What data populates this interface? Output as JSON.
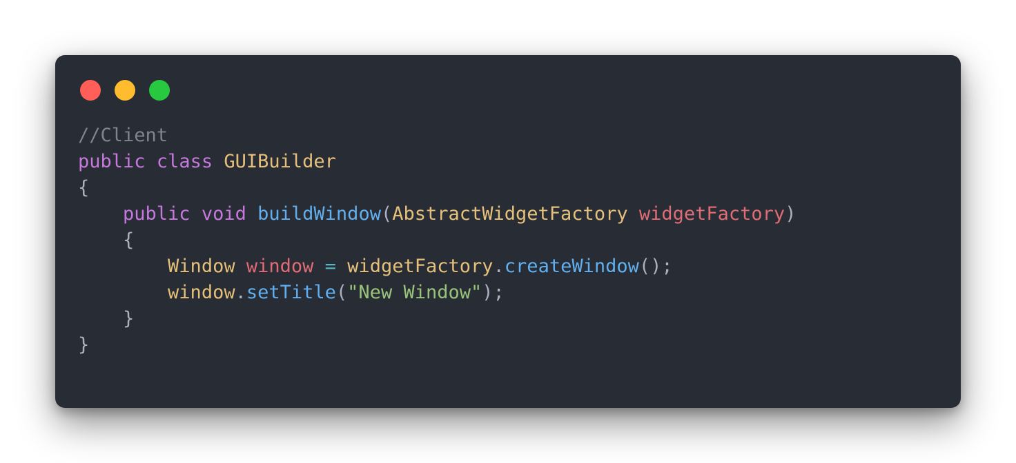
{
  "colors": {
    "page_background": "#ffffff",
    "window_background": "#282c34",
    "dot_red": "#ff5f57",
    "dot_yellow": "#febc2e",
    "dot_green": "#28c840",
    "comment": "#7f848e",
    "keyword": "#c678dd",
    "type": "#e5c07b",
    "function": "#61afef",
    "variable": "#e06c75",
    "string": "#98c379",
    "operator": "#56b6c2",
    "punctuation": "#abb2bf"
  },
  "window_controls": [
    {
      "name": "close",
      "color_key": "dot_red"
    },
    {
      "name": "minimize",
      "color_key": "dot_yellow"
    },
    {
      "name": "maximize",
      "color_key": "dot_green"
    }
  ],
  "code_lines": [
    [
      {
        "text": "//Client",
        "type": "comment"
      }
    ],
    [
      {
        "text": "public",
        "type": "keyword"
      },
      {
        "text": " ",
        "type": "punctuation"
      },
      {
        "text": "class",
        "type": "keyword"
      },
      {
        "text": " ",
        "type": "punctuation"
      },
      {
        "text": "GUIBuilder",
        "type": "type"
      }
    ],
    [
      {
        "text": "{",
        "type": "punctuation"
      }
    ],
    [
      {
        "text": "    ",
        "type": "punctuation"
      },
      {
        "text": "public",
        "type": "keyword"
      },
      {
        "text": " ",
        "type": "punctuation"
      },
      {
        "text": "void",
        "type": "keyword"
      },
      {
        "text": " ",
        "type": "punctuation"
      },
      {
        "text": "buildWindow",
        "type": "function"
      },
      {
        "text": "(",
        "type": "punctuation"
      },
      {
        "text": "AbstractWidgetFactory",
        "type": "type"
      },
      {
        "text": " ",
        "type": "punctuation"
      },
      {
        "text": "widgetFactory",
        "type": "variable"
      },
      {
        "text": ")",
        "type": "punctuation"
      }
    ],
    [
      {
        "text": "    ",
        "type": "punctuation"
      },
      {
        "text": "{",
        "type": "punctuation"
      }
    ],
    [
      {
        "text": "        ",
        "type": "punctuation"
      },
      {
        "text": "Window",
        "type": "type"
      },
      {
        "text": " ",
        "type": "punctuation"
      },
      {
        "text": "window",
        "type": "variable"
      },
      {
        "text": " ",
        "type": "punctuation"
      },
      {
        "text": "=",
        "type": "operator"
      },
      {
        "text": " ",
        "type": "punctuation"
      },
      {
        "text": "widgetFactory",
        "type": "type"
      },
      {
        "text": ".",
        "type": "punctuation"
      },
      {
        "text": "createWindow",
        "type": "function"
      },
      {
        "text": "();",
        "type": "punctuation"
      }
    ],
    [
      {
        "text": "        ",
        "type": "punctuation"
      },
      {
        "text": "window",
        "type": "type"
      },
      {
        "text": ".",
        "type": "punctuation"
      },
      {
        "text": "setTitle",
        "type": "function"
      },
      {
        "text": "(",
        "type": "punctuation"
      },
      {
        "text": "\"New Window\"",
        "type": "string"
      },
      {
        "text": ");",
        "type": "punctuation"
      }
    ],
    [
      {
        "text": "    ",
        "type": "punctuation"
      },
      {
        "text": "}",
        "type": "punctuation"
      }
    ],
    [
      {
        "text": "}",
        "type": "punctuation"
      }
    ]
  ]
}
